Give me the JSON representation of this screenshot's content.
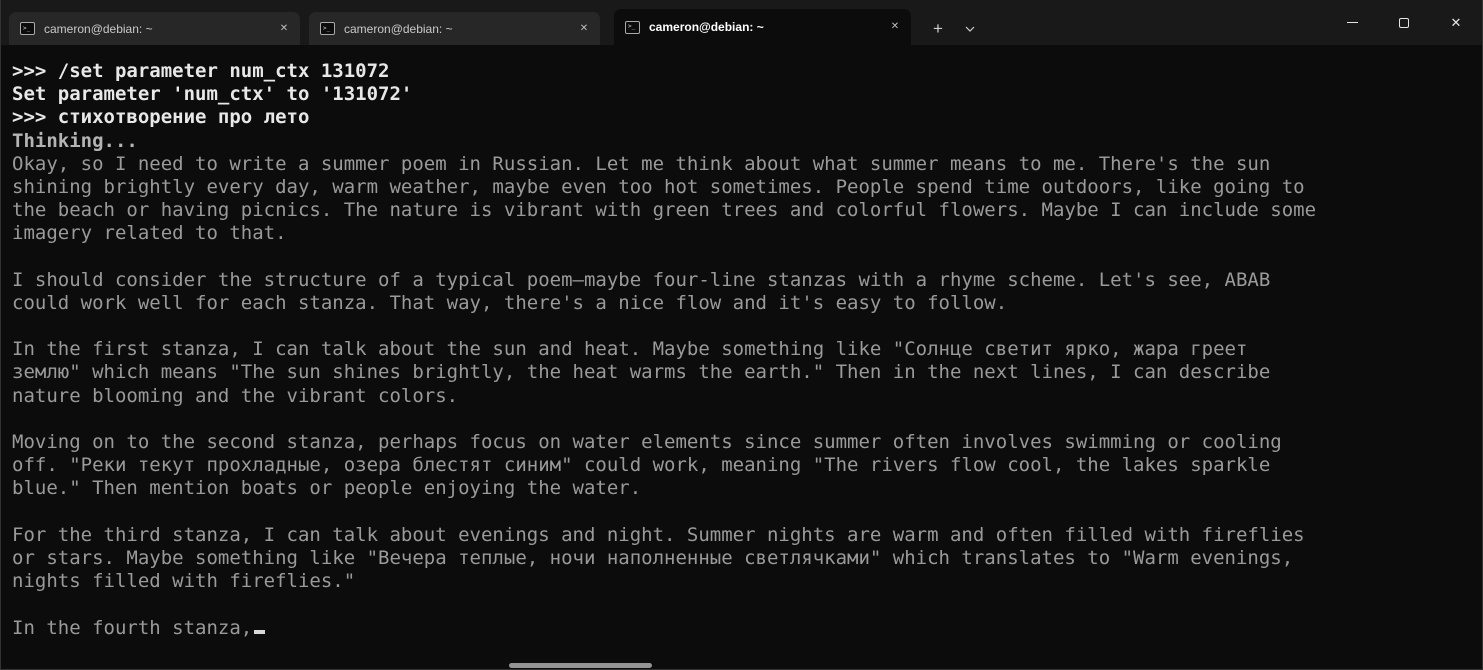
{
  "window": {
    "tabs": [
      {
        "title": "cameron@debian: ~",
        "active": false
      },
      {
        "title": "cameron@debian: ~",
        "active": false
      },
      {
        "title": "cameron@debian: ~",
        "active": true
      }
    ],
    "glyphs": {
      "terminal_icon": ">_",
      "new_tab": "+",
      "close": "✕"
    }
  },
  "colors": {
    "titlebar_bg": "#191919",
    "inactive_tab_bg": "#272727",
    "active_tab_bg": "#0c0c0c",
    "terminal_bg": "#0c0c0c",
    "command_text": "#e8e8e8",
    "thinking_text": "#9a9a9a"
  },
  "terminal": {
    "lines": [
      {
        "style": "cmd",
        "text": ">>> /set parameter num_ctx 131072"
      },
      {
        "style": "cmd",
        "text": "Set parameter 'num_ctx' to '131072'"
      },
      {
        "style": "cmd",
        "text": ">>> стихотворение про лето"
      },
      {
        "style": "thinkhead",
        "text": "Thinking..."
      },
      {
        "style": "think",
        "text": "Okay, so I need to write a summer poem in Russian. Let me think about what summer means to me. There's the sun"
      },
      {
        "style": "think",
        "text": "shining brightly every day, warm weather, maybe even too hot sometimes. People spend time outdoors, like going to"
      },
      {
        "style": "think",
        "text": "the beach or having picnics. The nature is vibrant with green trees and colorful flowers. Maybe I can include some"
      },
      {
        "style": "think",
        "text": "imagery related to that."
      },
      {
        "style": "blank",
        "text": ""
      },
      {
        "style": "think",
        "text": "I should consider the structure of a typical poem—maybe four-line stanzas with a rhyme scheme. Let's see, ABAB"
      },
      {
        "style": "think",
        "text": "could work well for each stanza. That way, there's a nice flow and it's easy to follow."
      },
      {
        "style": "blank",
        "text": ""
      },
      {
        "style": "think",
        "text": "In the first stanza, I can talk about the sun and heat. Maybe something like \"Солнце светит ярко, жара греет"
      },
      {
        "style": "think",
        "text": "землю\" which means \"The sun shines brightly, the heat warms the earth.\" Then in the next lines, I can describe"
      },
      {
        "style": "think",
        "text": "nature blooming and the vibrant colors."
      },
      {
        "style": "blank",
        "text": ""
      },
      {
        "style": "think",
        "text": "Moving on to the second stanza, perhaps focus on water elements since summer often involves swimming or cooling"
      },
      {
        "style": "think",
        "text": "off. \"Реки текут прохладные, озера блестят синим\" could work, meaning \"The rivers flow cool, the lakes sparkle"
      },
      {
        "style": "think",
        "text": "blue.\" Then mention boats or people enjoying the water."
      },
      {
        "style": "blank",
        "text": ""
      },
      {
        "style": "think",
        "text": "For the third stanza, I can talk about evenings and night. Summer nights are warm and often filled with fireflies"
      },
      {
        "style": "think",
        "text": "or stars. Maybe something like \"Вечера теплые, ночи наполненные светлячками\" which translates to \"Warm evenings,"
      },
      {
        "style": "think",
        "text": "nights filled with fireflies.\""
      },
      {
        "style": "blank",
        "text": ""
      },
      {
        "style": "think",
        "text": "In the fourth stanza,",
        "cursor": true
      }
    ]
  }
}
